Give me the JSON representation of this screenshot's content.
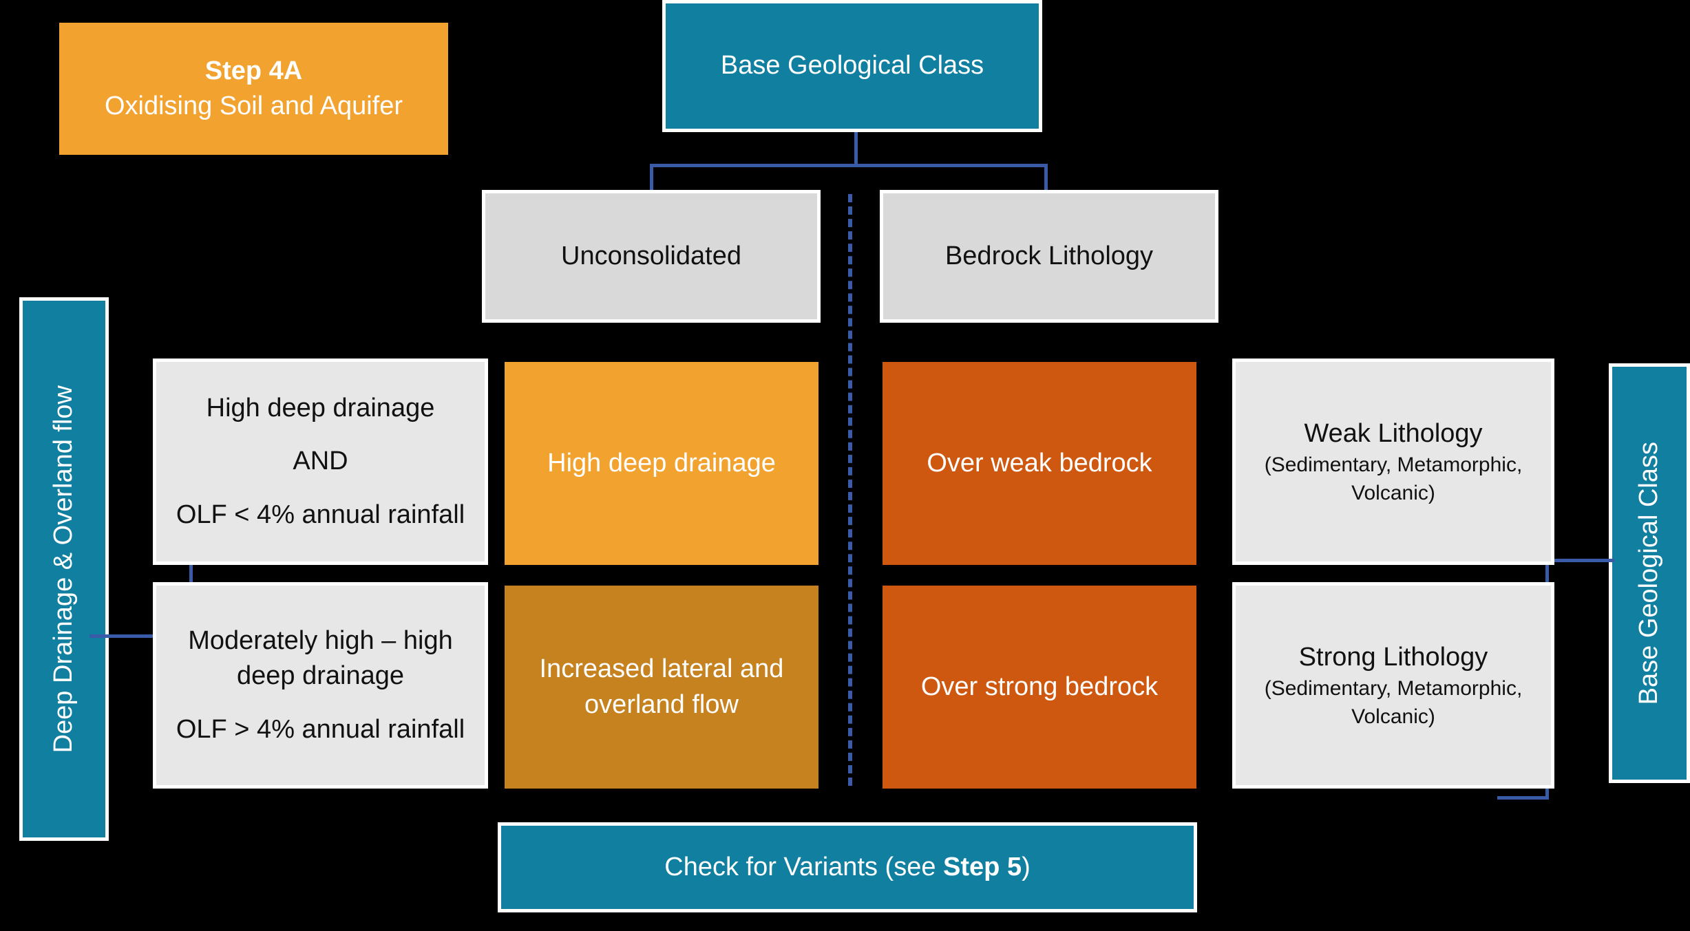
{
  "step_banner": {
    "title": "Step 4A",
    "subtitle": "Oxidising Soil and Aquifer"
  },
  "top_node": {
    "label": "Base Geological Class"
  },
  "branches": [
    {
      "label": "Unconsolidated"
    },
    {
      "label": "Bedrock Lithology"
    }
  ],
  "left_axis": {
    "label": "Deep Drainage & Overland flow"
  },
  "right_axis": {
    "label": "Base Geological Class"
  },
  "rows": [
    {
      "condition": {
        "line1": "High deep drainage",
        "line2": "AND",
        "line3": "OLF < 4% annual rainfall"
      },
      "unconsolidated_outcome": "High deep drainage",
      "bedrock_outcome": "Over weak bedrock",
      "lithology": {
        "title": "Weak Lithology",
        "detail": "(Sedimentary, Metamorphic, Volcanic)"
      }
    },
    {
      "condition": {
        "line1": "Moderately high – high",
        "line2": "deep drainage",
        "line3": "OLF > 4% annual rainfall"
      },
      "unconsolidated_outcome": "Increased lateral and overland flow",
      "bedrock_outcome": "Over strong bedrock",
      "lithology": {
        "title": "Strong Lithology",
        "detail": "(Sedimentary, Metamorphic, Volcanic)"
      }
    }
  ],
  "footer": {
    "prefix": "Check for Variants (see ",
    "emphasis": "Step 5",
    "suffix": ")"
  },
  "colors": {
    "teal": "#117FA0",
    "orange": "#F2A22E",
    "bronze": "#C5821F",
    "rust": "#CF5811",
    "grey_dark": "#D9D9D9",
    "grey_light": "#E7E7E7",
    "connector": "#3A5BA8",
    "background": "#000000"
  }
}
